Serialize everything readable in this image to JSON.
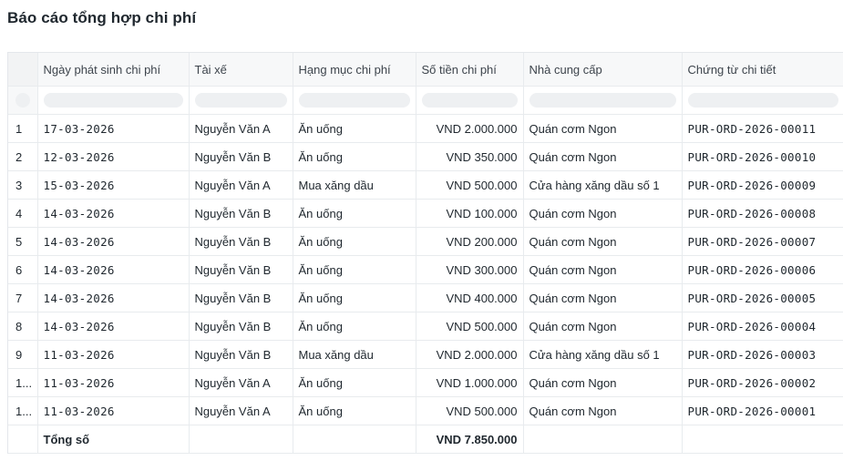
{
  "page_title": "Báo cáo tổng hợp chi phí",
  "columns": [
    "Ngày phát sinh chi phí",
    "Tài xế",
    "Hạng mục chi phí",
    "Số tiền chi phí",
    "Nhà cung cấp",
    "Chứng từ chi tiết"
  ],
  "rows": [
    {
      "idx": "1",
      "date": "17-03-2026",
      "driver": "Nguyễn Văn A",
      "category": "Ăn uống",
      "amount": "VND 2.000.000",
      "supplier": "Quán cơm Ngon",
      "doc": "PUR-ORD-2026-00011"
    },
    {
      "idx": "2",
      "date": "12-03-2026",
      "driver": "Nguyễn Văn B",
      "category": "Ăn uống",
      "amount": "VND 350.000",
      "supplier": "Quán cơm Ngon",
      "doc": "PUR-ORD-2026-00010"
    },
    {
      "idx": "3",
      "date": "15-03-2026",
      "driver": "Nguyễn Văn A",
      "category": "Mua xăng dầu",
      "amount": "VND 500.000",
      "supplier": "Cửa hàng xăng dầu số 1",
      "doc": "PUR-ORD-2026-00009"
    },
    {
      "idx": "4",
      "date": "14-03-2026",
      "driver": "Nguyễn Văn B",
      "category": "Ăn uống",
      "amount": "VND 100.000",
      "supplier": "Quán cơm Ngon",
      "doc": "PUR-ORD-2026-00008"
    },
    {
      "idx": "5",
      "date": "14-03-2026",
      "driver": "Nguyễn Văn B",
      "category": "Ăn uống",
      "amount": "VND 200.000",
      "supplier": "Quán cơm Ngon",
      "doc": "PUR-ORD-2026-00007"
    },
    {
      "idx": "6",
      "date": "14-03-2026",
      "driver": "Nguyễn Văn B",
      "category": "Ăn uống",
      "amount": "VND 300.000",
      "supplier": "Quán cơm Ngon",
      "doc": "PUR-ORD-2026-00006"
    },
    {
      "idx": "7",
      "date": "14-03-2026",
      "driver": "Nguyễn Văn B",
      "category": "Ăn uống",
      "amount": "VND 400.000",
      "supplier": "Quán cơm Ngon",
      "doc": "PUR-ORD-2026-00005"
    },
    {
      "idx": "8",
      "date": "14-03-2026",
      "driver": "Nguyễn Văn B",
      "category": "Ăn uống",
      "amount": "VND 500.000",
      "supplier": "Quán cơm Ngon",
      "doc": "PUR-ORD-2026-00004"
    },
    {
      "idx": "9",
      "date": "11-03-2026",
      "driver": "Nguyễn Văn B",
      "category": "Mua xăng dầu",
      "amount": "VND 2.000.000",
      "supplier": "Cửa hàng xăng dầu số 1",
      "doc": "PUR-ORD-2026-00003"
    },
    {
      "idx": "1...",
      "date": "11-03-2026",
      "driver": "Nguyễn Văn A",
      "category": "Ăn uống",
      "amount": "VND 1.000.000",
      "supplier": "Quán cơm Ngon",
      "doc": "PUR-ORD-2026-00002"
    },
    {
      "idx": "1...",
      "date": "11-03-2026",
      "driver": "Nguyễn Văn A",
      "category": "Ăn uống",
      "amount": "VND 500.000",
      "supplier": "Quán cơm Ngon",
      "doc": "PUR-ORD-2026-00001"
    }
  ],
  "total": {
    "label": "Tổng số",
    "amount": "VND 7.850.000"
  }
}
